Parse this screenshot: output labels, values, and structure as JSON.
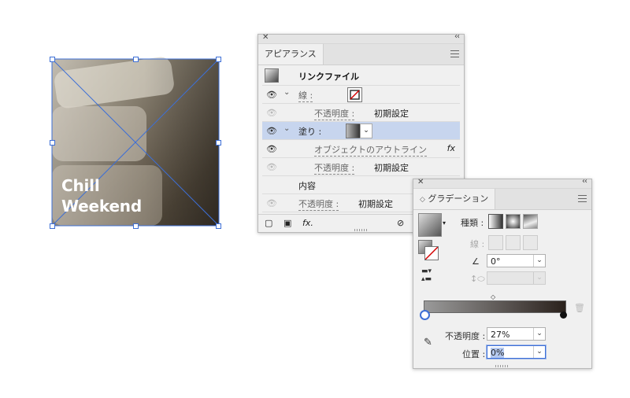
{
  "artwork": {
    "line1": "Chill",
    "line2": "Weekend"
  },
  "appearance_panel": {
    "tab_label": "アピアランス",
    "header_title": "リンクファイル",
    "rows": [
      {
        "label": "線 :",
        "icon": "stroke-none-swatch"
      },
      {
        "label": "不透明度 :",
        "value": "初期設定"
      },
      {
        "label": "塗り :",
        "icon": "gradient-swatch"
      },
      {
        "label": "オブジェクトのアウトライン",
        "icon": "fx-icon"
      },
      {
        "label": "不透明度 :",
        "value": "初期設定"
      },
      {
        "label": "内容"
      },
      {
        "label": "不透明度 :",
        "value": "初期設定"
      }
    ],
    "fx_label": "fx.",
    "fx_row_icon": "fx"
  },
  "gradient_panel": {
    "tab_label": "グラデーション",
    "type_label": "種類 :",
    "stroke_label": "線 :",
    "angle_value": "0°",
    "opacity_label": "不透明度 :",
    "opacity_value": "27%",
    "position_label": "位置 :",
    "position_value": "0%",
    "stop_left_color": "#ffffff",
    "stop_right_color": "#111111",
    "gradient_start": "#9a9a9a",
    "gradient_end": "#2a211c"
  },
  "colors": {
    "selection": "#c7d5ee",
    "accent": "#3d6fd6"
  }
}
